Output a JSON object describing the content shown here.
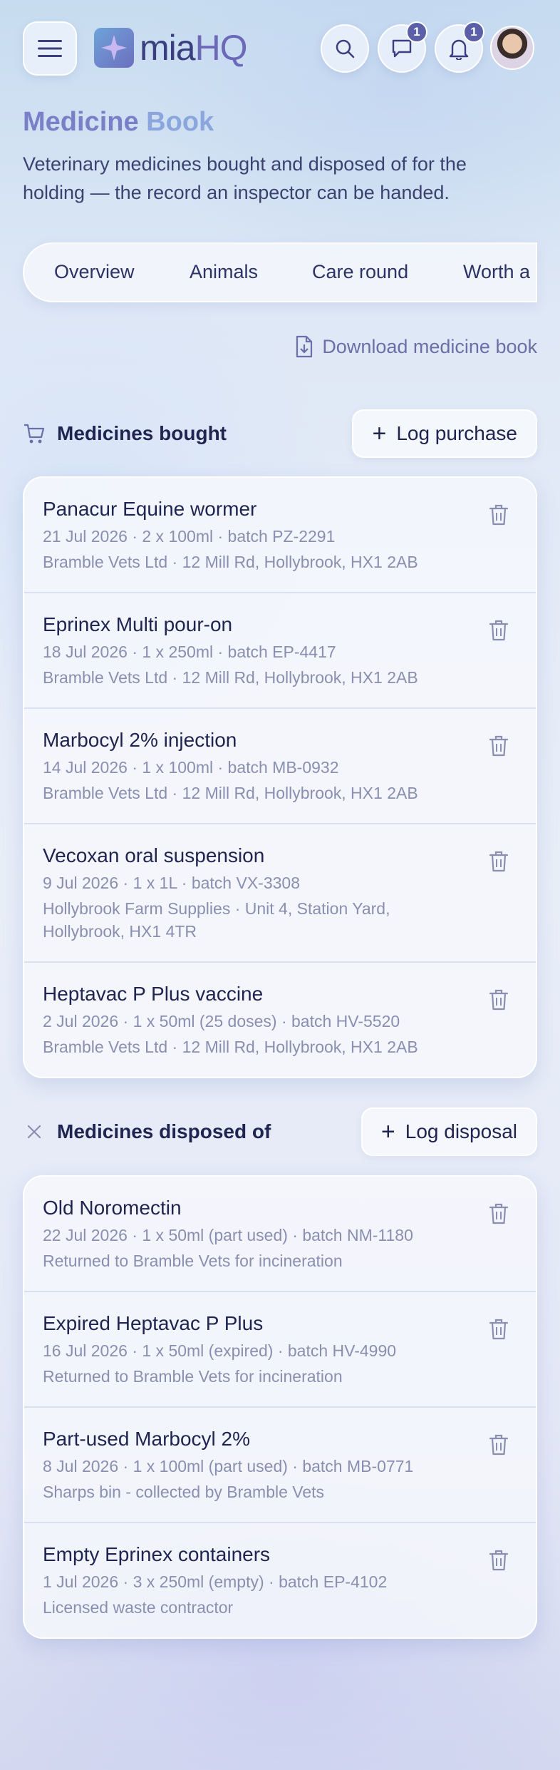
{
  "brand": {
    "name_a": "mia",
    "name_b": "HQ"
  },
  "header": {
    "messages_count": "1",
    "notifications_count": "1"
  },
  "page": {
    "title_a": "Medicine",
    "title_b": "Book",
    "description": "Veterinary medicines bought and disposed of for the holding — the record an inspector can be handed."
  },
  "tabs": [
    {
      "label": "Overview"
    },
    {
      "label": "Animals"
    },
    {
      "label": "Care round"
    },
    {
      "label": "Worth a"
    }
  ],
  "download_label": "Download medicine book",
  "bought": {
    "title": "Medicines bought",
    "action_label": "Log purchase",
    "items": [
      {
        "name": "Panacur Equine wormer",
        "meta": "21 Jul 2026 · 2 x 100ml · batch PZ-2291",
        "sub": "Bramble Vets Ltd · 12 Mill Rd, Hollybrook, HX1 2AB"
      },
      {
        "name": "Eprinex Multi pour-on",
        "meta": "18 Jul 2026 · 1 x 250ml · batch EP-4417",
        "sub": "Bramble Vets Ltd · 12 Mill Rd, Hollybrook, HX1 2AB"
      },
      {
        "name": "Marbocyl 2% injection",
        "meta": "14 Jul 2026 · 1 x 100ml · batch MB-0932",
        "sub": "Bramble Vets Ltd · 12 Mill Rd, Hollybrook, HX1 2AB"
      },
      {
        "name": "Vecoxan oral suspension",
        "meta": "9 Jul 2026 · 1 x 1L · batch VX-3308",
        "sub": "Hollybrook Farm Supplies · Unit 4, Station Yard, Hollybrook, HX1 4TR"
      },
      {
        "name": "Heptavac P Plus vaccine",
        "meta": "2 Jul 2026 · 1 x 50ml (25 doses) · batch HV-5520",
        "sub": "Bramble Vets Ltd · 12 Mill Rd, Hollybrook, HX1 2AB"
      }
    ]
  },
  "disposed": {
    "title": "Medicines disposed of",
    "action_label": "Log disposal",
    "items": [
      {
        "name": "Old Noromectin",
        "meta": "22 Jul 2026 · 1 x 50ml (part used) · batch NM-1180",
        "sub": "Returned to Bramble Vets for incineration"
      },
      {
        "name": "Expired Heptavac P Plus",
        "meta": "16 Jul 2026 · 1 x 50ml (expired) · batch HV-4990",
        "sub": "Returned to Bramble Vets for incineration"
      },
      {
        "name": "Part-used Marbocyl 2%",
        "meta": "8 Jul 2026 · 1 x 100ml (part used) · batch MB-0771",
        "sub": "Sharps bin - collected by Bramble Vets"
      },
      {
        "name": "Empty Eprinex containers",
        "meta": "1 Jul 2026 · 3 x 250ml (empty) · batch EP-4102",
        "sub": "Licensed waste contractor"
      }
    ]
  },
  "colors": {
    "accent": "#6b69b8",
    "title_a": "#7b7fc8",
    "title_b": "#8aa6dc",
    "text": "#1f2450",
    "muted": "#8a8fb0"
  },
  "icons": [
    "menu-icon",
    "search-icon",
    "chat-icon",
    "bell-icon",
    "download-icon",
    "cart-icon",
    "close-icon",
    "plus-icon",
    "trash-icon"
  ]
}
